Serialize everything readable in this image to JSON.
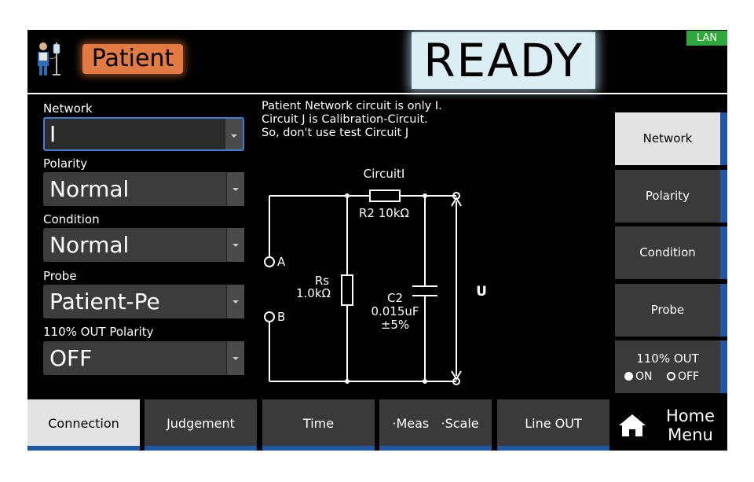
{
  "header": {
    "mode_label": "Patient",
    "status": "READY",
    "lan": "LAN"
  },
  "settings": {
    "network": {
      "label": "Network",
      "value": "I"
    },
    "polarity": {
      "label": "Polarity",
      "value": "Normal"
    },
    "condition": {
      "label": "Condition",
      "value": "Normal"
    },
    "probe": {
      "label": "Probe",
      "value": "Patient-Pe"
    },
    "out110": {
      "label": "110% OUT Polarity",
      "value": "OFF"
    }
  },
  "info": {
    "line1": "Patient Network circuit is only I.",
    "line2": "Circuit J is Calibration-Circuit.",
    "line3": "So, don't use test Circuit J"
  },
  "diagram": {
    "title": "CircuitI",
    "r2": "R2 10kΩ",
    "rs1": "Rs",
    "rs2": "1.0kΩ",
    "c2_1": "C2",
    "c2_2": "0.015uF",
    "c2_3": "±5%",
    "node_a": "A",
    "node_b": "B",
    "u": "U"
  },
  "right_menu": {
    "network": "Network",
    "polarity": "Polarity",
    "condition": "Condition",
    "probe": "Probe",
    "out110": "110% OUT",
    "on": "ON",
    "off": "OFF"
  },
  "bottom_bar": {
    "connection": "Connection",
    "judgement": "Judgement",
    "time": "Time",
    "meas_scale": "·Meas   ·Scale",
    "line_out": "Line OUT",
    "home1": "Home",
    "home2": "Menu"
  },
  "colors": {
    "mode_badge": "#e27a43",
    "status_banner": "#dbeef3",
    "lan_badge": "#2ea83c",
    "accent_blue": "#1f56a6"
  },
  "icons": {
    "mode": "patient-iv-icon",
    "home": "home-icon",
    "dropdown": "chevron-down-icon"
  }
}
